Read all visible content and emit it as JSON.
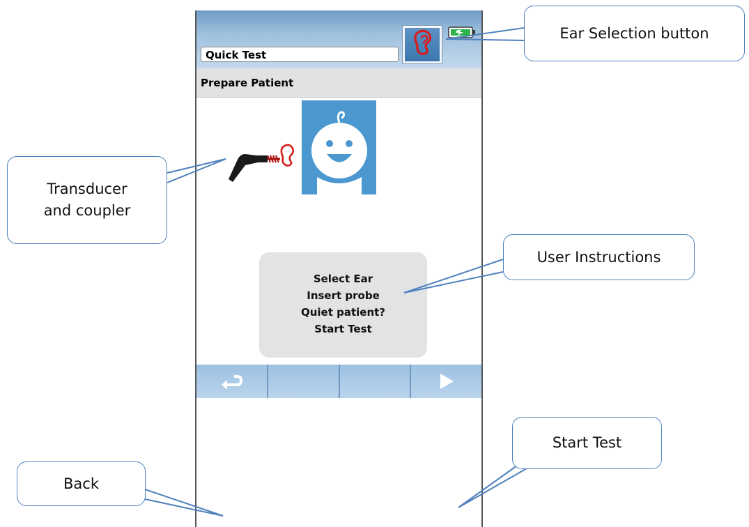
{
  "device": {
    "title_field": "Quick Test",
    "subheader": "Prepare Patient",
    "instructions": [
      "Select Ear",
      "Insert probe",
      "Quiet patient?",
      "Start Test"
    ]
  },
  "icons": {
    "ear_button": "ear-icon",
    "battery": "battery-icon",
    "back": "return-arrow-icon",
    "start": "play-triangle-icon",
    "baby": "baby-face-icon",
    "probe": "probe-transducer-icon"
  },
  "colors": {
    "ear_red": "#d81b1b",
    "header_blue": "#7fa8cf",
    "battery_green": "#2db34a",
    "callout_border": "#4f81bd"
  },
  "callouts": {
    "ear_selection": "Ear Selection button",
    "transducer_line1": "Transducer",
    "transducer_line2": "and coupler",
    "user_instructions": "User Instructions",
    "start_test": "Start Test",
    "back": "Back"
  }
}
